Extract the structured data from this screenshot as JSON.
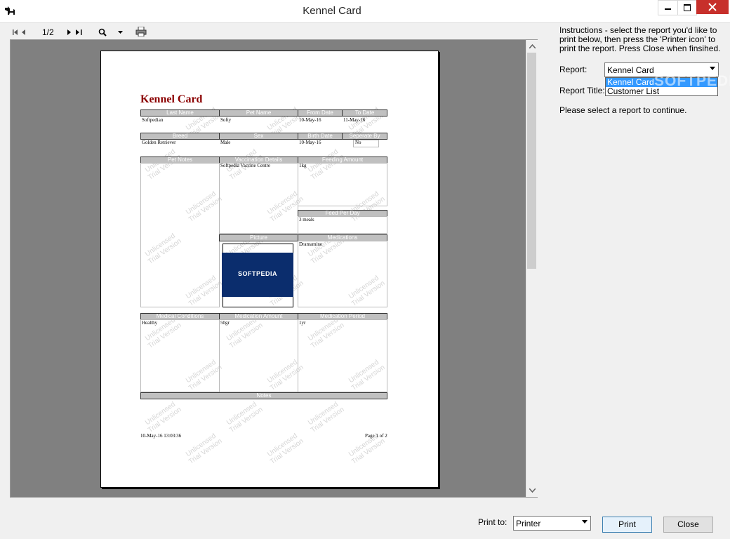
{
  "window": {
    "title": "Kennel Card"
  },
  "toolbar": {
    "page_indicator": "1/2"
  },
  "report": {
    "title": "Kennel Card",
    "headers": {
      "last_name": "Last Name",
      "pet_name": "Pet Name",
      "from_date": "From Date",
      "to_date": "To Date",
      "breed": "Breed",
      "sex": "Sex",
      "birth_date": "Birth Date",
      "seperate_by": "Seperate By",
      "pet_notes": "Pet Notes",
      "vaccination_details": "Vaccination Details",
      "feeding_amount": "Feeding Amount",
      "feed_per_day": "Feed Per Day",
      "picture": "Picture",
      "medications": "Medications",
      "medical_conditions": "Medical Conditions",
      "medication_amount": "Medication Amount",
      "medication_period": "Medication Period",
      "notes": "Notes"
    },
    "values": {
      "last_name": "Softpedian",
      "pet_name": "Softy",
      "from_date": "10-May-16",
      "to_date": "11-May-16",
      "breed": "Golden Retriever",
      "sex": "Male",
      "birth_date": "10-May-16",
      "seperate_by": "No",
      "vaccination_details": "Softpedia Vaccine Centre",
      "feeding_amount": "1kg",
      "feed_per_day": "3 meals",
      "medications": "Dramamine",
      "medical_conditions": "Healthy",
      "medication_amount": "50gr",
      "medication_period": "1yr"
    },
    "picture_logo": "SOFTPEDIA",
    "footer_timestamp": "10-May-16 13:03:36",
    "footer_page": "Page 1 of 2",
    "watermark_line1": "Unlicensed",
    "watermark_line2": "Trial Version"
  },
  "panel": {
    "instructions": "Instructions - select the report you'd like to print below, then press the 'Printer icon' to print the report. Press Close when finsihed.",
    "report_label": "Report:",
    "report_selected": "Kennel Card",
    "report_options": [
      "Kennel Card",
      "Customer List"
    ],
    "report_title_label": "Report Title:",
    "message": "Please select a report to continue.",
    "softpedia_watermark": "SOFTPEDIA"
  },
  "bottom": {
    "print_to_label": "Print to:",
    "print_to_value": "Printer",
    "print_button": "Print",
    "close_button": "Close"
  },
  "colors": {
    "title_red": "#8b0000",
    "close_red": "#c7302b",
    "select_blue": "#3399ff",
    "logo_blue": "#0b2d6d"
  }
}
